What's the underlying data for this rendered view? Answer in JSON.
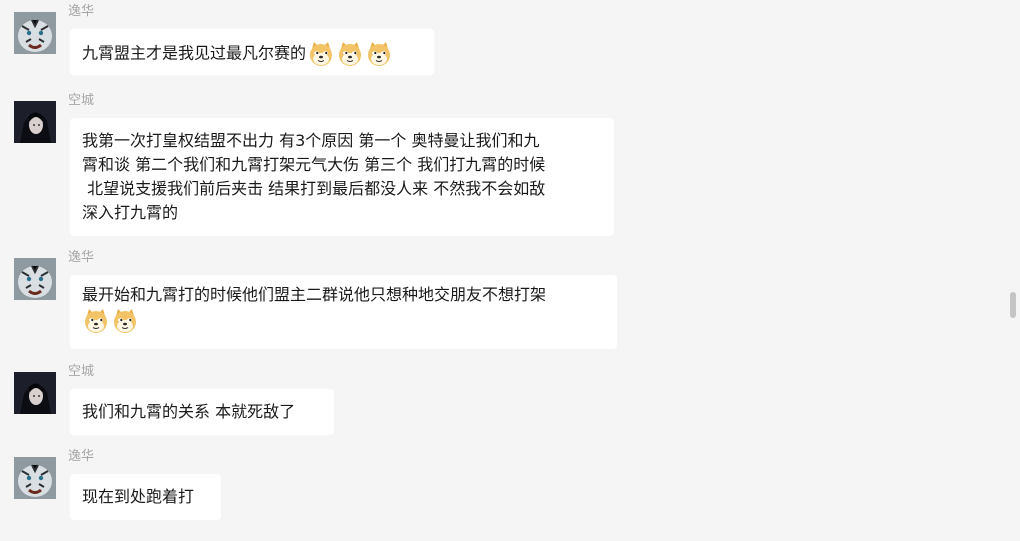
{
  "messages": [
    {
      "sender": "逸华",
      "avatar": "tiger-avatar",
      "text": "九霄盟主才是我见过最凡尔赛的",
      "emoji_count": 3
    },
    {
      "sender": "空城",
      "avatar": "anime-avatar",
      "text": "我第一次打皇权结盟不出力 有3个原因 第一个 奥特曼让我们和九\n霄和谈 第二个我们和九霄打架元气大伤 第三个 我们打九霄的时候\n 北望说支援我们前后夹击 结果打到最后都没人来 不然我不会如敌\n深入打九霄的",
      "emoji_count": 0
    },
    {
      "sender": "逸华",
      "avatar": "tiger-avatar",
      "text": "最开始和九霄打的时候他们盟主二群说他只想种地交朋友不想打架\n",
      "emoji_count": 2
    },
    {
      "sender": "空城",
      "avatar": "anime-avatar",
      "text": "我们和九霄的关系 本就死敌了",
      "emoji_count": 0
    },
    {
      "sender": "逸华",
      "avatar": "tiger-avatar",
      "text": "现在到处跑着打",
      "emoji_count": 0
    }
  ],
  "emoji_name": "doge-emoji",
  "colors": {
    "background": "#f5f5f5",
    "bubble": "#ffffff",
    "sender": "#a6a6a6",
    "text": "#1a1a1a"
  }
}
